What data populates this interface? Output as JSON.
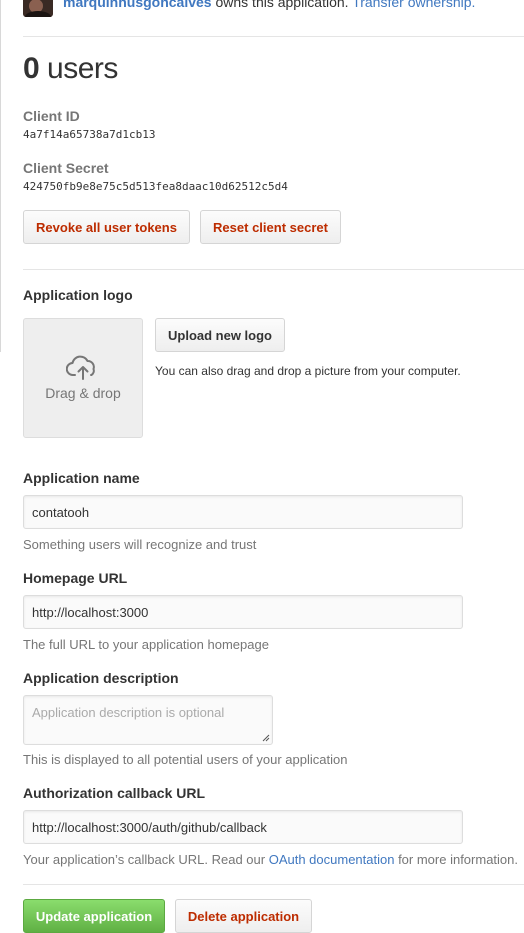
{
  "owner": {
    "username": "marquinhusgoncalves",
    "owns_text": " owns this application. ",
    "transfer_link": "Transfer ownership."
  },
  "users": {
    "count": "0",
    "label": " users"
  },
  "credentials": {
    "client_id_label": "Client ID",
    "client_id_value": "4a7f14a65738a7d1cb13",
    "client_secret_label": "Client Secret",
    "client_secret_value": "424750fb9e8e75c5d513fea8daac10d62512c5d4"
  },
  "actions": {
    "revoke_label": "Revoke all user tokens",
    "reset_label": "Reset client secret"
  },
  "logo": {
    "label": "Application logo",
    "dropzone_text": "Drag & drop",
    "upload_label": "Upload new logo",
    "hint": "You can also drag and drop a picture from your computer."
  },
  "form": {
    "name_label": "Application name",
    "name_value": "contatooh",
    "name_note": "Something users will recognize and trust",
    "homepage_label": "Homepage URL",
    "homepage_value": "http://localhost:3000",
    "homepage_note": "The full URL to your application homepage",
    "description_label": "Application description",
    "description_placeholder": "Application description is optional",
    "description_note": "This is displayed to all potential users of your application",
    "callback_label": "Authorization callback URL",
    "callback_value": "http://localhost:3000/auth/github/callback",
    "callback_note_prefix": "Your application’s callback URL. Read our ",
    "callback_note_link": "OAuth documentation",
    "callback_note_suffix": " for more information."
  },
  "footer": {
    "update_label": "Update application",
    "delete_label": "Delete application"
  },
  "colors": {
    "link": "#4078c0",
    "danger": "#bd2c00",
    "primary": "#6cc644"
  }
}
